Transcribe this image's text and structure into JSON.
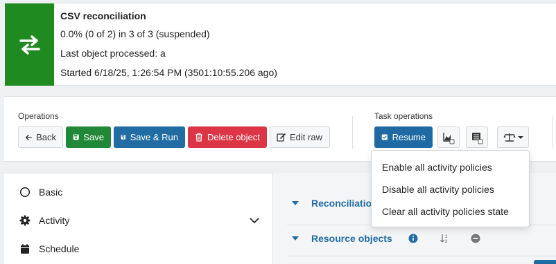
{
  "header": {
    "title": "CSV reconciliation",
    "progress": "0.0% (0 of 2) in 3 of 3 (suspended)",
    "last_object": "Last object processed: a",
    "started": "Started 6/18/25, 1:26:54 PM (3501:10:55.206 ago)",
    "icon": "swap-arrows-icon",
    "icon_color": "#1f8a1f"
  },
  "operations": {
    "label": "Operations",
    "back": "Back",
    "save": "Save",
    "save_run": "Save & Run",
    "delete": "Delete object",
    "edit_raw": "Edit raw"
  },
  "task_operations": {
    "label": "Task operations",
    "resume": "Resume"
  },
  "policy_menu": {
    "items": [
      "Enable all activity policies",
      "Disable all activity policies",
      "Clear all activity policies state"
    ]
  },
  "sidebar": {
    "items": [
      {
        "label": "Basic",
        "icon": "circle-outline-icon"
      },
      {
        "label": "Activity",
        "icon": "gear-icon",
        "expandable": true
      },
      {
        "label": "Schedule",
        "icon": "calendar-icon"
      }
    ]
  },
  "sections": {
    "reconciliation": "Reconciliatio",
    "resource_objects": "Resource objects"
  },
  "colors": {
    "primary": "#206ca3",
    "success": "#218838",
    "danger": "#dc3545"
  }
}
